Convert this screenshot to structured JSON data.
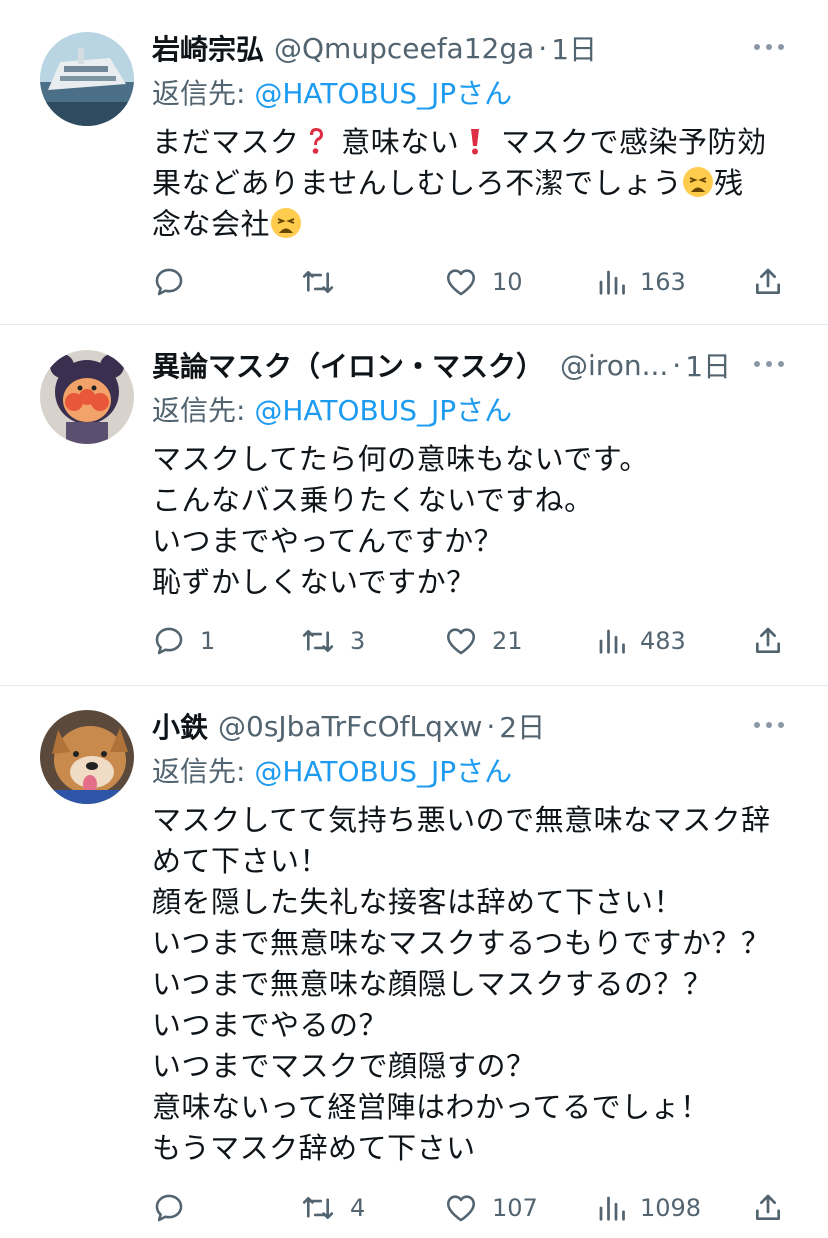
{
  "tweets": [
    {
      "name": "岩崎宗弘",
      "handle": "@Qmupceefa12ga",
      "time": "1日",
      "reply_prefix": "返信先: ",
      "reply_to": "@HATOBUS_JP",
      "reply_suffix": "さん",
      "lines": [
        "まだマスク",
        "意味ない",
        "マスクで感染予防効",
        "果などありませんしむしろ不潔でしょう",
        "残",
        "念な会社"
      ],
      "replies": "",
      "retweets": "",
      "likes": "10",
      "views": "163"
    },
    {
      "name": "異論マスク（イロン・マスク）",
      "handle": "@iron...",
      "time": "1日",
      "reply_prefix": "返信先: ",
      "reply_to": "@HATOBUS_JP",
      "reply_suffix": "さん",
      "body": "マスクしてたら何の意味もないです。\nこんなバス乗りたくないですね。\nいつまでやってんですか？\n恥ずかしくないですか？",
      "replies": "1",
      "retweets": "3",
      "likes": "21",
      "views": "483"
    },
    {
      "name": "小鉄",
      "handle": "@0sJbaTrFcOfLqxw",
      "time": "2日",
      "reply_prefix": "返信先: ",
      "reply_to": "@HATOBUS_JP",
      "reply_suffix": "さん",
      "body": "マスクしてて気持ち悪いので無意味なマスク辞\nめて下さい！\n顔を隠した失礼な接客は辞めて下さい！\nいつまで無意味なマスクするつもりですか？？\nいつまで無意味な顔隠しマスクするの？？\nいつまでやるの？\nいつまでマスクで顔隠すの？\n意味ないって経営陣はわかってるでしょ！\nもうマスク辞めて下さい",
      "replies": "",
      "retweets": "4",
      "likes": "107",
      "views": "1098"
    }
  ],
  "separator": "·",
  "colors": {
    "accent": "#1d9bf0",
    "secondary": "#536471",
    "text": "#0f1419",
    "divider": "#e6e9eb"
  },
  "icons": [
    "reply-icon",
    "retweet-icon",
    "like-icon",
    "views-icon",
    "share-icon",
    "more-icon",
    "question-emoji",
    "exclamation-emoji",
    "weary-face-emoji"
  ]
}
